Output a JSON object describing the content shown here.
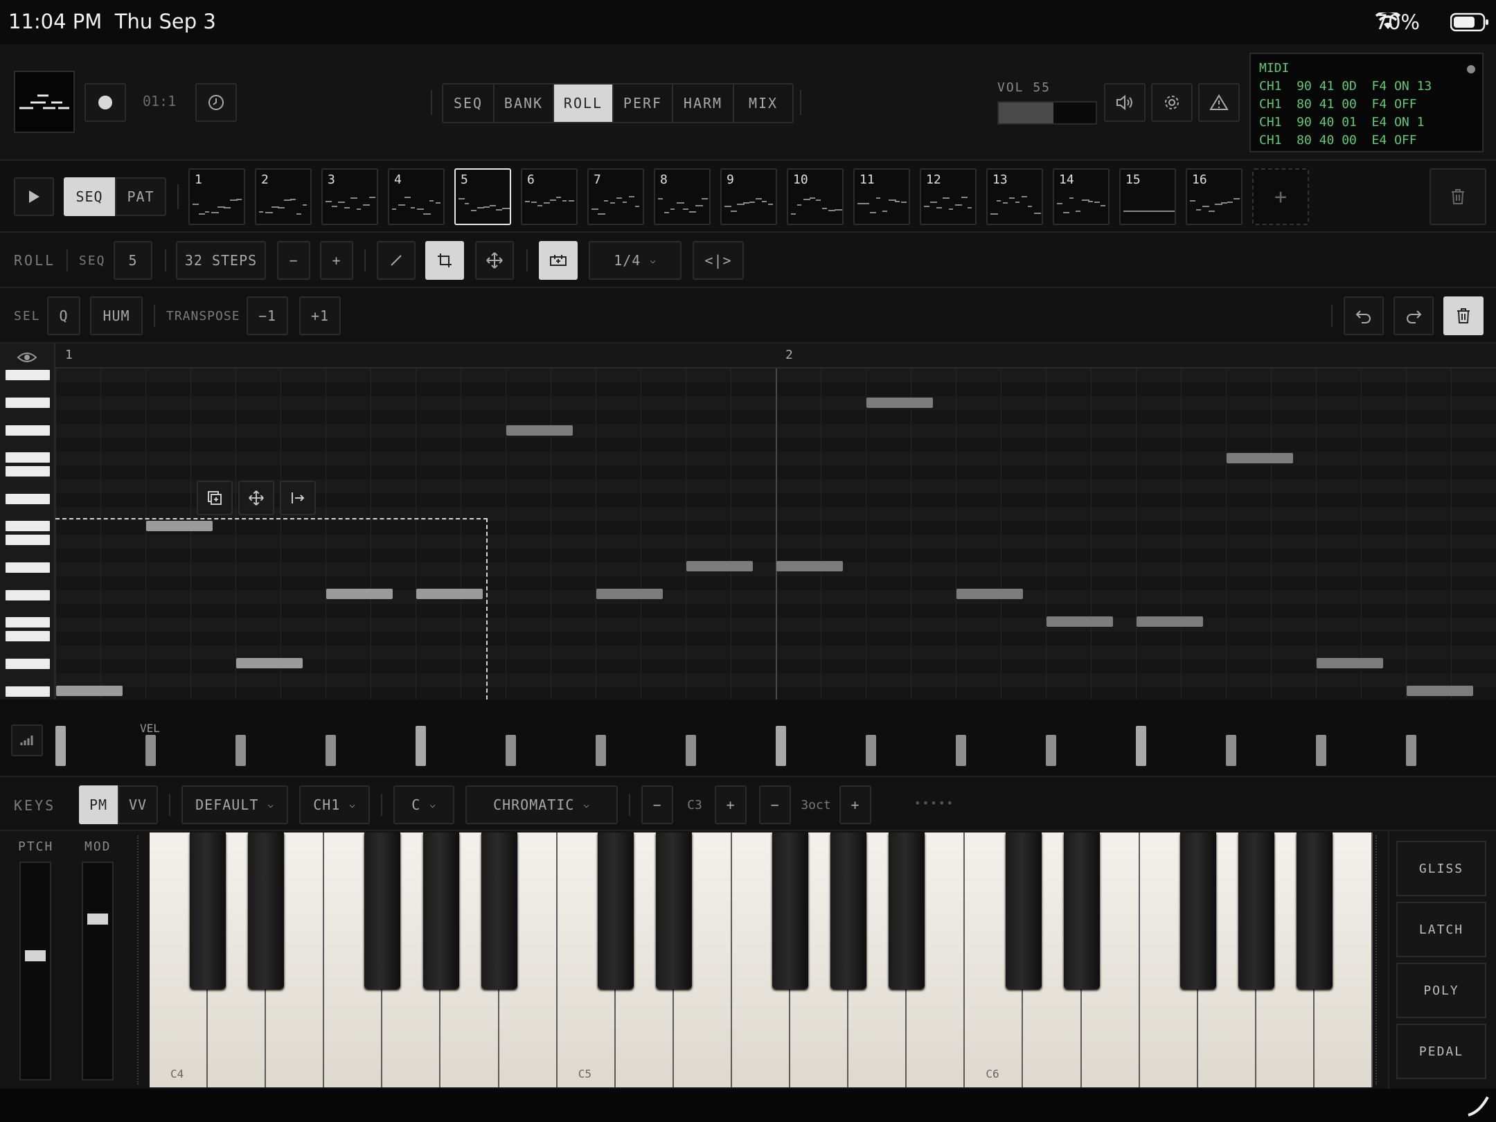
{
  "status": {
    "time": "11:04 PM",
    "date": "Thu Sep 3",
    "battery": "70%"
  },
  "transport": {
    "position": "01:1"
  },
  "views": [
    {
      "label": "SEQ",
      "active": false
    },
    {
      "label": "BANK",
      "active": false
    },
    {
      "label": "ROLL",
      "active": true
    },
    {
      "label": "PERF",
      "active": false
    },
    {
      "label": "HARM",
      "active": false
    },
    {
      "label": "MIX",
      "active": false
    }
  ],
  "volume": {
    "label": "VOL 55",
    "value": 55
  },
  "midi": {
    "title": "MIDI",
    "lines": [
      "CH1  90 41 0D  F4 ON 13",
      "CH1  80 41 00  F4 OFF",
      "CH1  90 40 01  E4 ON 1",
      "CH1  80 40 00  E4 OFF"
    ]
  },
  "patterns": {
    "seq_label": "SEQ",
    "pat_label": "PAT",
    "items": [
      "1",
      "2",
      "3",
      "4",
      "5",
      "6",
      "7",
      "8",
      "9",
      "10",
      "11",
      "12",
      "13",
      "14",
      "15",
      "16"
    ],
    "selected": "5",
    "add_label": "+"
  },
  "roll": {
    "title": "ROLL",
    "seq_label": "SEQ",
    "seq_value": "5",
    "steps": "32 STEPS",
    "minus": "−",
    "plus": "+",
    "grid": "1/4",
    "grid_chevron": "⌵",
    "fit": "<|>"
  },
  "select": {
    "sel_label": "SEL",
    "q_label": "Q",
    "hum_label": "HUM",
    "transpose_label": "TRANSPOSE",
    "minus_one": "−1",
    "plus_one": "+1"
  },
  "ruler": {
    "bar1": "1",
    "bar2": "2"
  },
  "velocity": {
    "label": "VEL",
    "values": [
      0.8,
      0.62,
      0.62,
      0.62,
      0.8,
      0.62,
      0.62,
      0.62,
      0.8,
      0.62,
      0.62,
      0.62,
      0.8,
      0.62,
      0.62,
      0.62
    ]
  },
  "keys": {
    "title": "KEYS",
    "pm": "PM",
    "vv": "VV",
    "preset": "DEFAULT",
    "channel": "CH1",
    "root": "C",
    "scale": "CHROMATIC",
    "minus": "−",
    "plus": "+",
    "octave": "C3",
    "range": "3oct",
    "dots": "•••••",
    "chevron": "⌵"
  },
  "wheels": {
    "pitch_label": "PTCH",
    "mod_label": "MOD",
    "pitch": 0.5,
    "mod": 0.35
  },
  "octaves": [
    "C4",
    "C5",
    "C6"
  ],
  "modes": [
    "GLISS",
    "LATCH",
    "POLY",
    "PEDAL"
  ]
}
